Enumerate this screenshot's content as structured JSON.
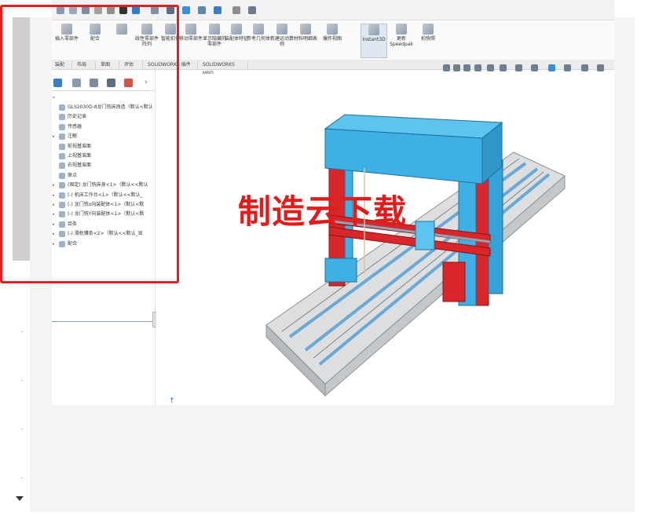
{
  "tree_panel": {
    "items": [
      {
        "label": "GLS2030D-8龙门铣床改造（默认<默认",
        "expand": "",
        "icon": "part-icon"
      },
      {
        "label": "历史记录",
        "expand": "",
        "icon": "history-icon"
      },
      {
        "label": "传感器",
        "expand": "",
        "icon": "sensor-icon"
      },
      {
        "label": "注解",
        "expand": "▸",
        "icon": "annotation-icon"
      },
      {
        "label": "前视基准面",
        "expand": "",
        "icon": "plane-icon"
      },
      {
        "label": "上视基准面",
        "expand": "",
        "icon": "plane-icon"
      },
      {
        "label": "右视基准面",
        "expand": "",
        "icon": "plane-icon"
      },
      {
        "label": "原点",
        "expand": "",
        "icon": "origin-icon"
      },
      {
        "label": "(固定) 龙门铣床身<1>（默认<<默认",
        "expand": "▸",
        "icon": "component-icon"
      },
      {
        "label": "(-) 机床工作台<1>（默认<<默认_",
        "expand": "▸",
        "icon": "component-icon"
      },
      {
        "label": "(-) 龙门铣x向装配体<1>（默认<默",
        "expand": "▸",
        "icon": "assembly-icon"
      },
      {
        "label": "(-) 龙门铣Y向装配体<1>（默认<默",
        "expand": "▸",
        "icon": "assembly-icon"
      },
      {
        "label": "齿条",
        "expand": "▸",
        "icon": "folder-icon"
      },
      {
        "label": "(-) 滑枕镶条<2>（默认<<默认_显",
        "expand": "▸",
        "icon": "component-icon"
      },
      {
        "label": "配合",
        "expand": "▸",
        "icon": "mates-icon"
      }
    ]
  },
  "ribbon": {
    "buttons": [
      {
        "label": "插入零部件",
        "icon": "insert-component-icon",
        "active": false
      },
      {
        "label": "配合",
        "icon": "mate-icon",
        "active": false
      },
      {
        "label": "",
        "icon": "component-preview-icon",
        "active": false
      },
      {
        "label": "线性零部件阵列",
        "icon": "pattern-icon",
        "active": false
      },
      {
        "label": "智能扣件",
        "icon": "fastener-icon",
        "active": false
      },
      {
        "label": "移动零部件",
        "icon": "move-component-icon",
        "active": false
      },
      {
        "label": "显示隐藏的零部件",
        "icon": "show-hidden-icon",
        "active": false
      },
      {
        "label": "装配体特征",
        "icon": "assembly-feature-icon",
        "active": false
      },
      {
        "label": "参考几何体",
        "icon": "reference-geometry-icon",
        "active": false
      },
      {
        "label": "新建运动算例",
        "icon": "motion-study-icon",
        "active": false
      },
      {
        "label": "材料明细表",
        "icon": "bom-icon",
        "active": false
      },
      {
        "label": "爆炸视图",
        "icon": "exploded-view-icon",
        "active": false
      },
      {
        "label": "Instant3D",
        "icon": "instant3d-icon",
        "active": true
      },
      {
        "label": "更新Speedpak",
        "icon": "speedpak-icon",
        "active": false
      },
      {
        "label": "拍快照",
        "icon": "snapshot-icon",
        "active": false
      }
    ]
  },
  "command_tabs": [
    "装配体",
    "布局",
    "草图",
    "评估",
    "SOLIDWORKS 插件",
    "SOLIDWORKS MBD"
  ],
  "watermark": {
    "text": "制造云下载"
  },
  "colors": {
    "highlight": "#e32020",
    "machine_blue": "#3fb0e6",
    "machine_red": "#d9262a",
    "bed_gray": "#c9ccce"
  }
}
